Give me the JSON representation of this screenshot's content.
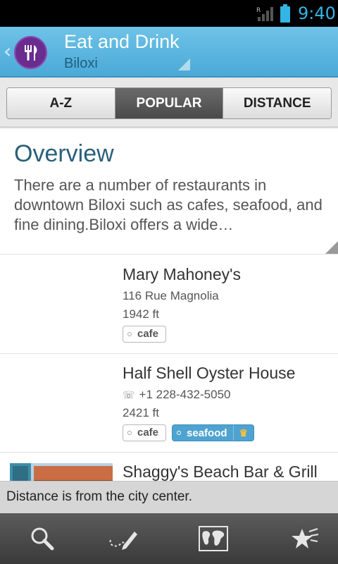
{
  "status_bar": {
    "time": "9:40",
    "roaming_indicator": "R"
  },
  "header": {
    "title": "Eat and Drink",
    "subtitle": "Biloxi",
    "icon": "fork-knife-icon"
  },
  "tabs": [
    {
      "label": "A-Z",
      "active": false
    },
    {
      "label": "POPULAR",
      "active": true
    },
    {
      "label": "DISTANCE",
      "active": false
    }
  ],
  "overview": {
    "heading": "Overview",
    "text": "There are a number of restaurants in downtown Biloxi such as cafes, seafood, and fine dining.Biloxi offers a wide…"
  },
  "places": [
    {
      "name": "Mary Mahoney's",
      "address": "116 Rue Magnolia",
      "phone": "",
      "distance": "1942 ft",
      "tags": [
        {
          "label": "cafe",
          "featured": false
        }
      ]
    },
    {
      "name": "Half Shell Oyster House",
      "address": "",
      "phone": "+1 228-432-5050",
      "distance": "2421 ft",
      "tags": [
        {
          "label": "cafe",
          "featured": false
        },
        {
          "label": "seafood",
          "featured": true
        }
      ]
    },
    {
      "name": "Shaggy's Beach Bar & Grill",
      "address": "",
      "phone": "",
      "distance": "",
      "tags": []
    }
  ],
  "toast": {
    "text": "Distance is from the city center."
  },
  "bottom_bar": {
    "buttons": [
      "search-icon",
      "edit-notes-icon",
      "map-icon",
      "favorites-icon"
    ]
  },
  "colors": {
    "action_bar": "#57b2de",
    "accent": "#33b5e5",
    "app_icon_bg": "#6a2c8f",
    "featured_tag": "#4fa3d0"
  }
}
